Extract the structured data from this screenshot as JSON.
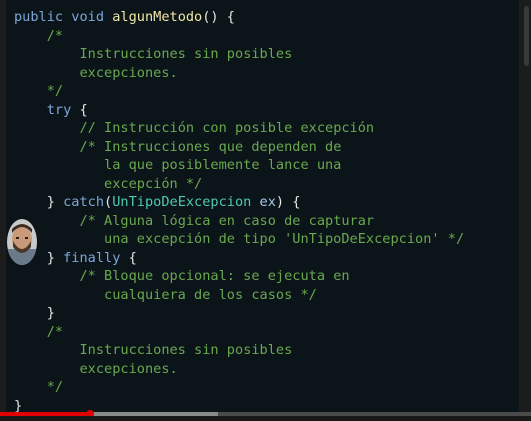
{
  "code": {
    "lines": [
      [
        [
          "kw",
          "public "
        ],
        [
          "kw",
          "void "
        ],
        [
          "fn",
          "algunMetodo"
        ],
        [
          "pl",
          "() {"
        ]
      ],
      [
        [
          "pl",
          "    "
        ],
        [
          "cm",
          "/*"
        ]
      ],
      [
        [
          "cm",
          "        Instrucciones sin posibles"
        ]
      ],
      [
        [
          "cm",
          "        excepciones."
        ]
      ],
      [
        [
          "pl",
          "    "
        ],
        [
          "cm",
          "*/"
        ]
      ],
      [
        [
          "pl",
          "    "
        ],
        [
          "kw",
          "try"
        ],
        [
          "pl",
          " {"
        ]
      ],
      [
        [
          "pl",
          "        "
        ],
        [
          "cm",
          "// Instrucción con posible excepción"
        ]
      ],
      [
        [
          "pl",
          "        "
        ],
        [
          "cm",
          "/* Instrucciones que dependen de"
        ]
      ],
      [
        [
          "cm",
          "           la que posiblemente lance una"
        ]
      ],
      [
        [
          "cm",
          "           excepción */"
        ]
      ],
      [
        [
          "pl",
          "    } "
        ],
        [
          "kw",
          "catch"
        ],
        [
          "pl",
          "("
        ],
        [
          "ty",
          "UnTipoDeExcepcion"
        ],
        [
          "pl",
          " "
        ],
        [
          "var",
          "ex"
        ],
        [
          "pl",
          ") {"
        ]
      ],
      [
        [
          "pl",
          "        "
        ],
        [
          "cm",
          "/* Alguna lógica en caso de capturar"
        ]
      ],
      [
        [
          "cm",
          "           una excepción de tipo 'UnTipoDeExcepcion' */"
        ]
      ],
      [
        [
          "pl",
          "    } "
        ],
        [
          "kw",
          "finally"
        ],
        [
          "pl",
          " {"
        ]
      ],
      [
        [
          "pl",
          "        "
        ],
        [
          "cm",
          "/* Bloque opcional: se ejecuta en"
        ]
      ],
      [
        [
          "cm",
          "           cualquiera de los casos */"
        ]
      ],
      [
        [
          "pl",
          "    }"
        ]
      ],
      [
        [
          "pl",
          "    "
        ],
        [
          "cm",
          "/*"
        ]
      ],
      [
        [
          "cm",
          "        Instrucciones sin posibles"
        ]
      ],
      [
        [
          "cm",
          "        excepciones."
        ]
      ],
      [
        [
          "pl",
          "    "
        ],
        [
          "cm",
          "*/"
        ]
      ],
      [
        [
          "pl",
          "}"
        ]
      ]
    ]
  },
  "video": {
    "played_fraction": 0.17,
    "buffered_fraction": 0.41
  },
  "colors": {
    "keyword": "#7ea6d8",
    "function": "#f0e6a8",
    "type": "#4ec9b0",
    "comment": "#6aa84f",
    "progress": "#e00000"
  }
}
